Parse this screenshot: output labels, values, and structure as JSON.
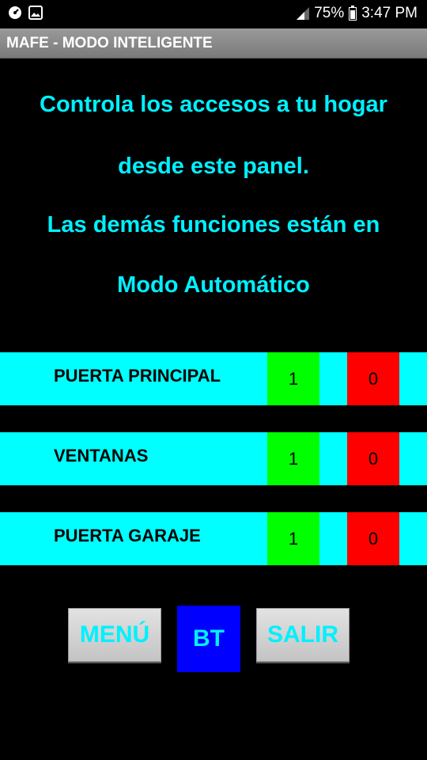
{
  "status_bar": {
    "battery_percent": "75%",
    "time": "3:47 PM",
    "left_icons": [
      "speedometer-icon",
      "image-icon"
    ]
  },
  "app": {
    "title": "MAFE - MODO INTELIGENTE"
  },
  "info": {
    "line1": "Controla los accesos a tu hogar",
    "line2": "desde este panel.",
    "line3": "Las demás funciones están en",
    "line4": "Modo Automático"
  },
  "controls": [
    {
      "label": "PUERTA PRINCIPAL",
      "on": "1",
      "off": "0"
    },
    {
      "label": "VENTANAS",
      "on": "1",
      "off": "0"
    },
    {
      "label": "PUERTA GARAJE",
      "on": "1",
      "off": "0"
    }
  ],
  "buttons": {
    "menu": "MENÚ",
    "bt": "BT",
    "salir": "SALIR"
  },
  "colors": {
    "accent_text": "#00f0ff",
    "row_bg": "#00ffff",
    "on_button": "#00ff00",
    "off_button": "#ff0000",
    "bt_button": "#0000ff"
  }
}
